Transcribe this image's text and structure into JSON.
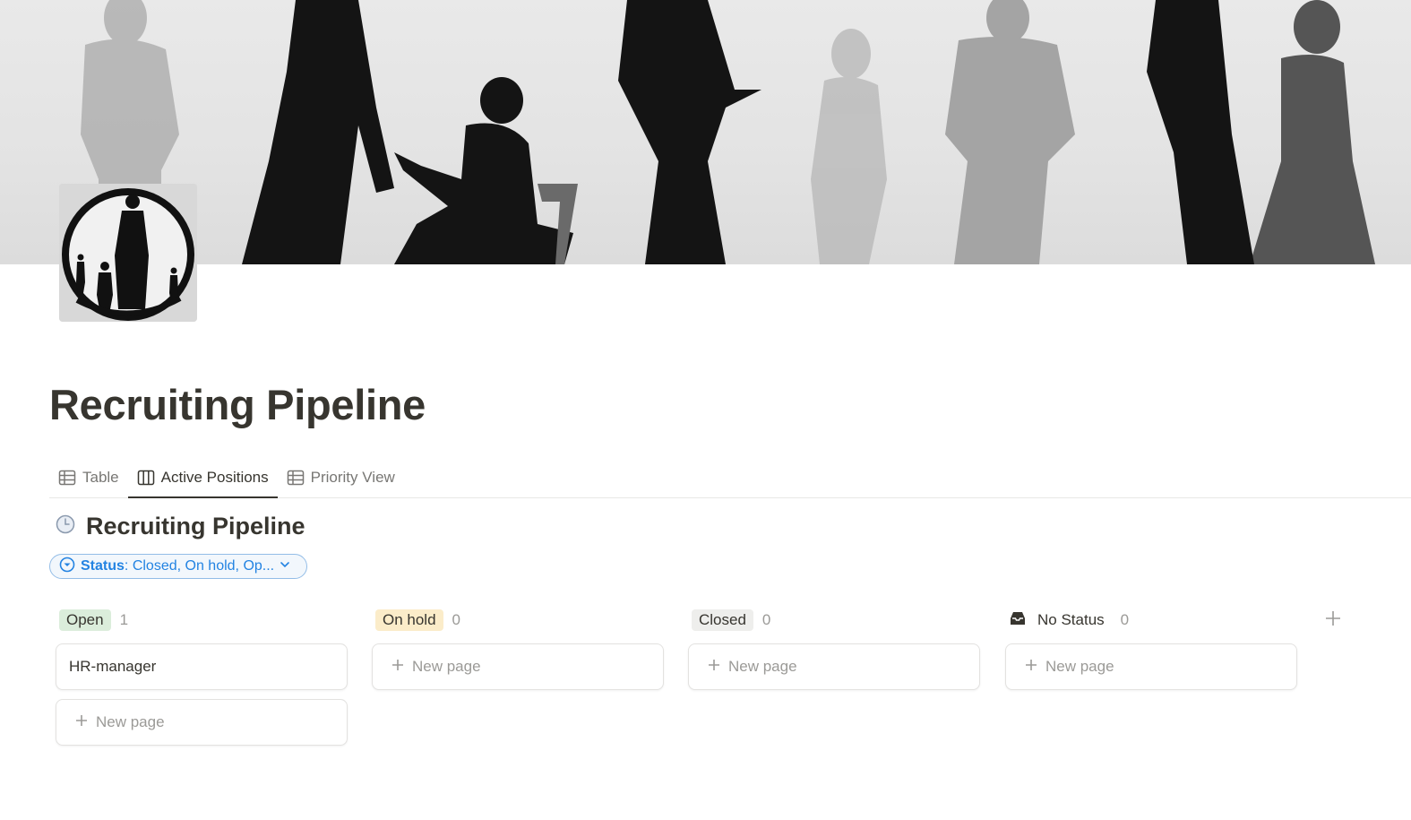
{
  "page": {
    "title": "Recruiting Pipeline",
    "cover": "people-silhouettes-cover-image",
    "icon": "people-silhouettes-circle-icon"
  },
  "tabs": [
    {
      "label": "Table",
      "icon": "table-icon",
      "active": false
    },
    {
      "label": "Active Positions",
      "icon": "board-icon",
      "active": true
    },
    {
      "label": "Priority View",
      "icon": "table-icon",
      "active": false
    }
  ],
  "database": {
    "title": "Recruiting Pipeline",
    "icon": "clock-icon"
  },
  "filter": {
    "key": "Status",
    "sep": ":",
    "value": "Closed, On hold, Op...",
    "icon": "status-filter-icon",
    "color": "#2383e2"
  },
  "board": {
    "columns": [
      {
        "label": "Open",
        "count": "1",
        "color": "#dbeddb",
        "cards": [
          "HR-manager"
        ],
        "new_label": "New page"
      },
      {
        "label": "On hold",
        "count": "0",
        "color": "#fbecc9",
        "cards": [],
        "new_label": "New page"
      },
      {
        "label": "Closed",
        "count": "0",
        "color": "#eeeeec",
        "cards": [],
        "new_label": "New page"
      },
      {
        "label": "No Status",
        "count": "0",
        "color": "#ffffff",
        "icon": "inbox-icon",
        "cards": [],
        "new_label": "New page"
      }
    ],
    "add_column_icon": "plus-icon"
  }
}
